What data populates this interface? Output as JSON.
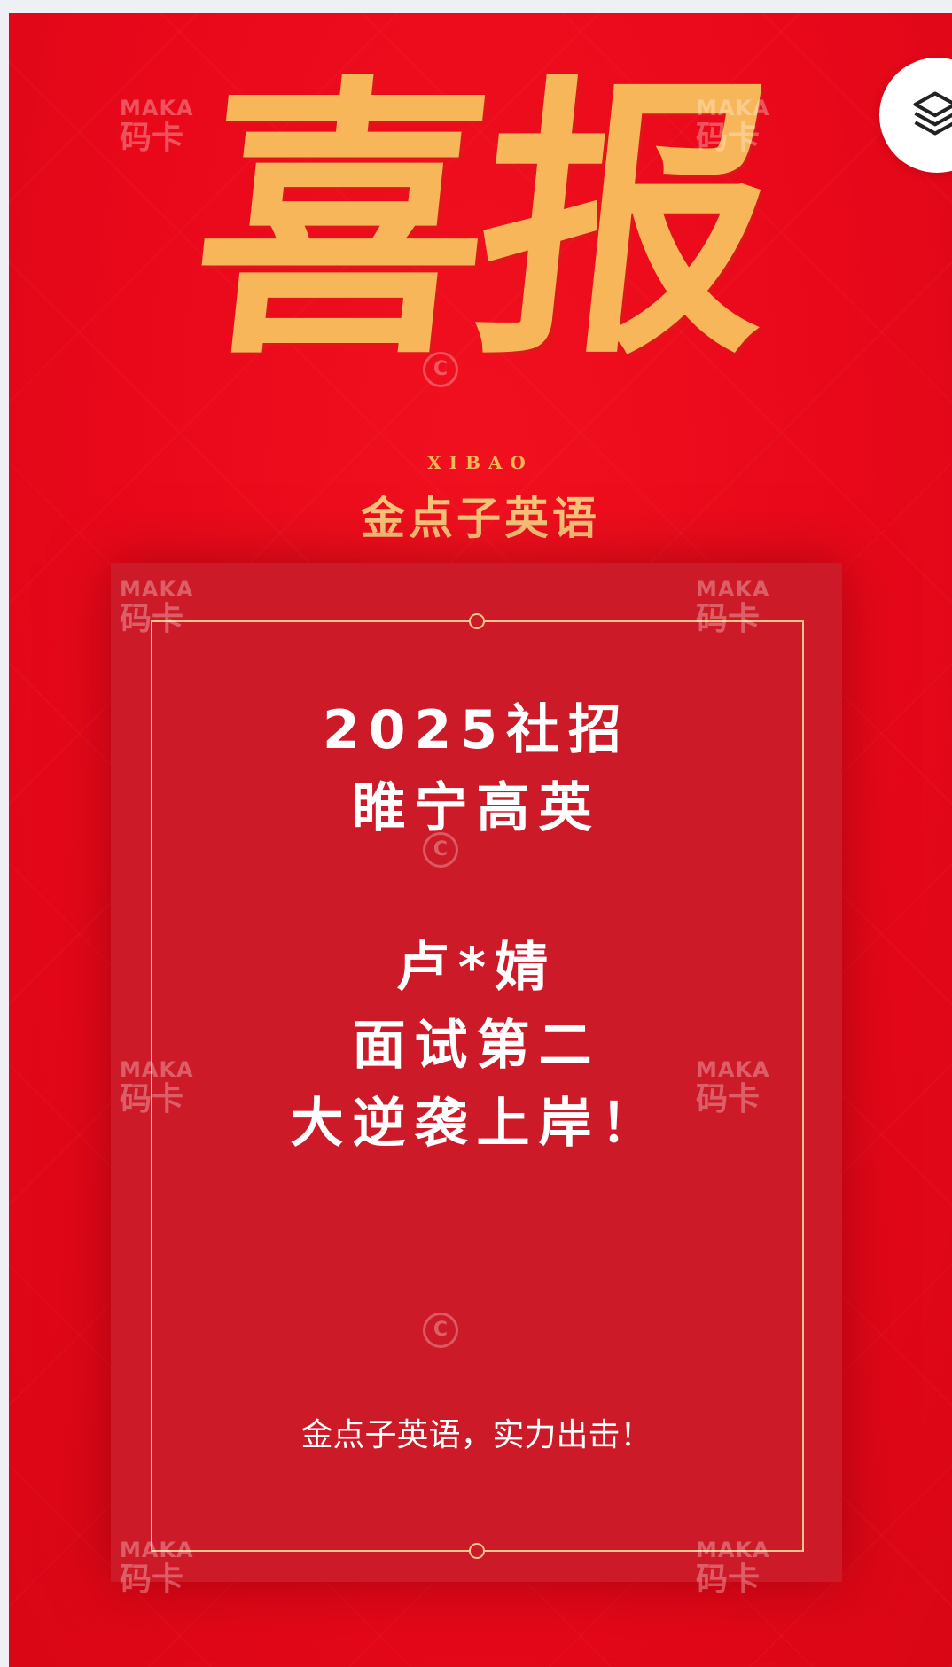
{
  "poster": {
    "headline": "喜报",
    "headline_pinyin": "XIBAO",
    "brand": "金点子英语",
    "card": {
      "lines": [
        "2025社招",
        "睢宁高英",
        "",
        "卢*婧",
        "面试第二",
        "大逆袭上岸！"
      ],
      "slogan": "金点子英语，实力出击！"
    },
    "watermark": {
      "brand_en": "MAKA",
      "brand_zh": "码卡",
      "copyright_symbol": "C"
    }
  },
  "toolbar": {
    "layers_icon": "layers-icon"
  },
  "colors": {
    "background": "#e8081a",
    "card": "#cd1a28",
    "gold": "#f7b65a",
    "frame": "#f2c88a",
    "text": "#ffffff"
  }
}
